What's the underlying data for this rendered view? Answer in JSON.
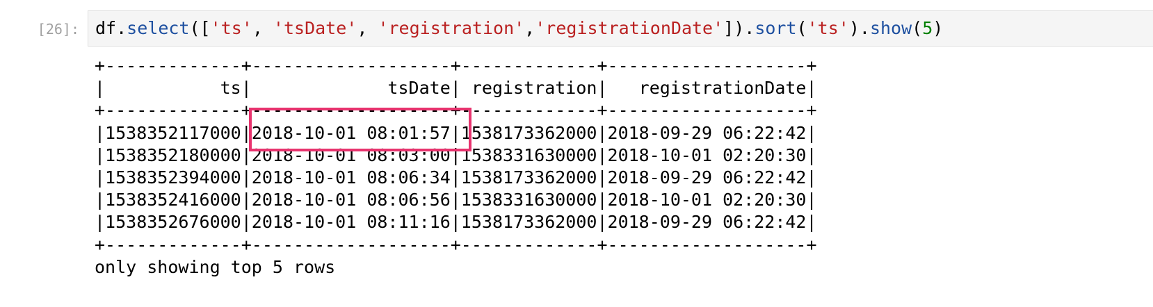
{
  "cell": {
    "prompt": "[26]:",
    "code": {
      "obj": "df",
      "dot1": ".",
      "select_fn": "select",
      "open": "([",
      "arg1": "'ts'",
      "sep1": ", ",
      "arg2": "'tsDate'",
      "sep2": ", ",
      "arg3": "'registration'",
      "sep3": ",",
      "arg4": "'registrationDate'",
      "close1": "]).",
      "sort_fn": "sort",
      "open2": "(",
      "sort_arg": "'ts'",
      "close2": ").",
      "show_fn": "show",
      "open3": "(",
      "show_arg": "5",
      "close3": ")"
    }
  },
  "output": {
    "border_top": "+-------------+-------------------+-------------+-------------------+",
    "header": "|           ts|             tsDate| registration|   registrationDate|",
    "border_mid": "+-------------+-------------------+-------------+-------------------+",
    "rows": [
      "|1538352117000|2018-10-01 08:01:57|1538173362000|2018-09-29 06:22:42|",
      "|1538352180000|2018-10-01 08:03:00|1538331630000|2018-10-01 02:20:30|",
      "|1538352394000|2018-10-01 08:06:34|1538173362000|2018-09-29 06:22:42|",
      "|1538352416000|2018-10-01 08:06:56|1538331630000|2018-10-01 02:20:30|",
      "|1538352676000|2018-10-01 08:11:16|1538173362000|2018-09-29 06:22:42|"
    ],
    "border_bottom": "+-------------+-------------------+-------------+-------------------+",
    "footer": "only showing top 5 rows"
  },
  "colors": {
    "highlight": "#e8336e",
    "string": "#ba2121",
    "function": "#1e50a0",
    "number": "#008000",
    "prompt": "#a0a0a0"
  }
}
